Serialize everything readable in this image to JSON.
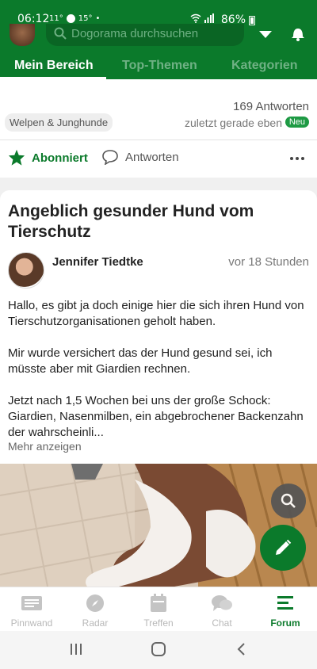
{
  "status_bar": {
    "time": "06:12",
    "left_info": "11°",
    "weather": "15°",
    "battery": "86%"
  },
  "header": {
    "search_placeholder": "Dogorama durchsuchen",
    "tabs": [
      {
        "label": "Mein Bereich",
        "active": true
      },
      {
        "label": "Top-Themen",
        "active": false
      },
      {
        "label": "Kategorien",
        "active": false
      }
    ],
    "colors": {
      "primary": "#0b7a2b"
    }
  },
  "thread": {
    "answers": "169 Antworten",
    "tag": "Welpen & Junghunde",
    "latest": "zuletzt gerade eben",
    "new_badge": "Neu",
    "subscribed_label": "Abonniert",
    "reply_label": "Antworten"
  },
  "post": {
    "title": "Angeblich gesunder Hund vom Tierschutz",
    "author": "Jennifer Tiedtke",
    "time": "vor 18 Stunden",
    "paragraphs": [
      "Hallo, es gibt ja doch einige hier die sich ihren Hund von Tierschutzorganisationen geholt haben.",
      "Mir wurde versichert das der Hund gesund sei, ich müsste aber mit Giardien rechnen.",
      "Jetzt nach 1,5 Wochen bei uns der große Schock: Giardien, Nasenmilben, ein abgebrochener Backenzahn der wahrscheinli..."
    ],
    "more_label": "Mehr anzeigen"
  },
  "bottom_nav": [
    {
      "label": "Pinnwand",
      "icon": "pinboard-icon",
      "active": false
    },
    {
      "label": "Radar",
      "icon": "compass-icon",
      "active": false
    },
    {
      "label": "Treffen",
      "icon": "calendar-icon",
      "active": false
    },
    {
      "label": "Chat",
      "icon": "chat-icon",
      "active": false
    },
    {
      "label": "Forum",
      "icon": "forum-icon",
      "active": true
    }
  ]
}
